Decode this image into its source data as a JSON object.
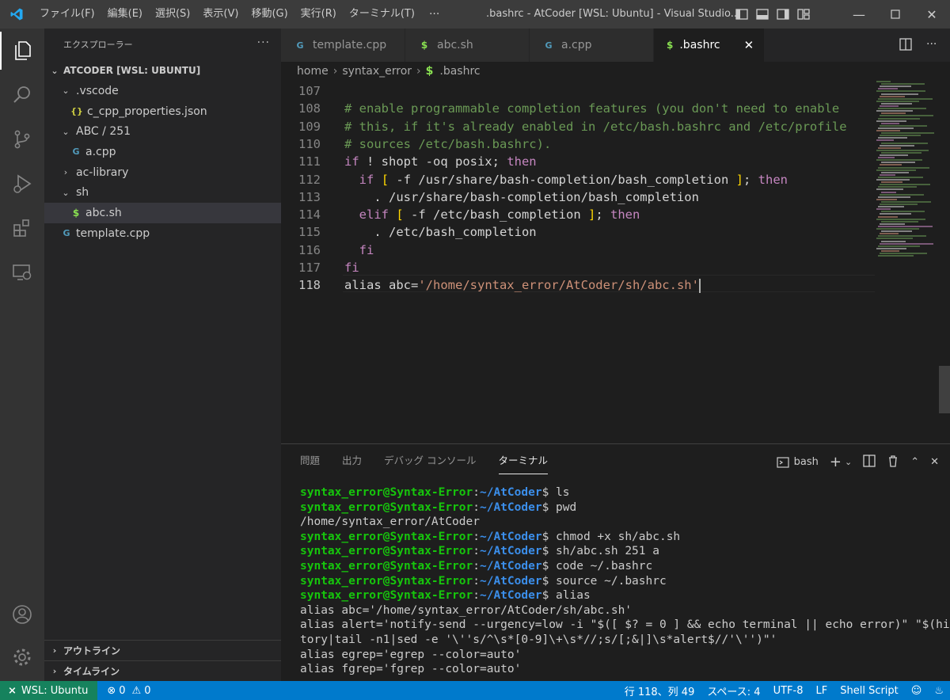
{
  "titlebar": {
    "menu": [
      "ファイル(F)",
      "編集(E)",
      "選択(S)",
      "表示(V)",
      "移動(G)",
      "実行(R)",
      "ターミナル(T)"
    ],
    "more": "···",
    "title": ".bashrc - AtCoder [WSL: Ubuntu] - Visual Studio..."
  },
  "sidebar": {
    "header": "エクスプローラー",
    "more": "···",
    "root": "ATCODER [WSL: UBUNTU]",
    "items": [
      {
        "label": ".vscode",
        "type": "folder",
        "expanded": true
      },
      {
        "label": "c_cpp_properties.json",
        "type": "json"
      },
      {
        "label": "ABC / 251",
        "type": "folder",
        "expanded": true
      },
      {
        "label": "a.cpp",
        "type": "cpp"
      },
      {
        "label": "ac-library",
        "type": "folder",
        "expanded": false
      },
      {
        "label": "sh",
        "type": "folder",
        "expanded": true
      },
      {
        "label": "abc.sh",
        "type": "sh",
        "selected": true
      },
      {
        "label": "template.cpp",
        "type": "cpp"
      }
    ],
    "outline": "アウトライン",
    "timeline": "タイムライン"
  },
  "tabs": [
    {
      "label": "template.cpp",
      "icon": "cpp"
    },
    {
      "label": "abc.sh",
      "icon": "sh"
    },
    {
      "label": "a.cpp",
      "icon": "cpp"
    },
    {
      "label": ".bashrc",
      "icon": "sh",
      "active": true
    }
  ],
  "breadcrumb": [
    "home",
    "syntax_error",
    ".bashrc"
  ],
  "editor": {
    "lines": [
      {
        "n": "107",
        "tokens": []
      },
      {
        "n": "108",
        "tokens": [
          {
            "t": "# enable programmable completion features (you don't need to enable",
            "c": "comment"
          }
        ]
      },
      {
        "n": "109",
        "tokens": [
          {
            "t": "# this, if it's already enabled in /etc/bash.bashrc and /etc/profile",
            "c": "comment"
          }
        ]
      },
      {
        "n": "110",
        "tokens": [
          {
            "t": "# sources /etc/bash.bashrc).",
            "c": "comment"
          }
        ]
      },
      {
        "n": "111",
        "tokens": [
          {
            "t": "if",
            "c": "kw"
          },
          {
            "t": " ! shopt -oq posix; ",
            "c": "plain"
          },
          {
            "t": "then",
            "c": "kw"
          }
        ]
      },
      {
        "n": "112",
        "tokens": [
          {
            "t": "  ",
            "c": "plain"
          },
          {
            "t": "if",
            "c": "kw"
          },
          {
            "t": " ",
            "c": "plain"
          },
          {
            "t": "[",
            "c": "br"
          },
          {
            "t": " -f /usr/share/bash-completion/bash_completion ",
            "c": "plain"
          },
          {
            "t": "]",
            "c": "br"
          },
          {
            "t": "; ",
            "c": "plain"
          },
          {
            "t": "then",
            "c": "kw"
          }
        ]
      },
      {
        "n": "113",
        "tokens": [
          {
            "t": "    . /usr/share/bash-completion/bash_completion",
            "c": "plain"
          }
        ]
      },
      {
        "n": "114",
        "tokens": [
          {
            "t": "  ",
            "c": "plain"
          },
          {
            "t": "elif",
            "c": "kw"
          },
          {
            "t": " ",
            "c": "plain"
          },
          {
            "t": "[",
            "c": "br"
          },
          {
            "t": " -f /etc/bash_completion ",
            "c": "plain"
          },
          {
            "t": "]",
            "c": "br"
          },
          {
            "t": "; ",
            "c": "plain"
          },
          {
            "t": "then",
            "c": "kw"
          }
        ]
      },
      {
        "n": "115",
        "tokens": [
          {
            "t": "    . /etc/bash_completion",
            "c": "plain"
          }
        ]
      },
      {
        "n": "116",
        "tokens": [
          {
            "t": "  ",
            "c": "plain"
          },
          {
            "t": "fi",
            "c": "kw"
          }
        ]
      },
      {
        "n": "117",
        "tokens": [
          {
            "t": "fi",
            "c": "kw"
          }
        ]
      },
      {
        "n": "118",
        "tokens": [
          {
            "t": "alias abc=",
            "c": "plain"
          },
          {
            "t": "'/home/syntax_error/AtCoder/sh/abc.sh'",
            "c": "str"
          }
        ],
        "current": true
      }
    ]
  },
  "panel": {
    "tabs": [
      "問題",
      "出力",
      "デバッグ コンソール",
      "ターミナル"
    ],
    "active_tab": "ターミナル",
    "shell": "bash",
    "terminal": [
      {
        "user": "syntax_error@Syntax-Error",
        "path": "~/AtCoder",
        "cmd": "ls"
      },
      {
        "user": "syntax_error@Syntax-Error",
        "path": "~/AtCoder",
        "cmd": "pwd"
      },
      {
        "out": "/home/syntax_error/AtCoder"
      },
      {
        "user": "syntax_error@Syntax-Error",
        "path": "~/AtCoder",
        "cmd": "chmod +x sh/abc.sh"
      },
      {
        "user": "syntax_error@Syntax-Error",
        "path": "~/AtCoder",
        "cmd": "sh/abc.sh 251 a"
      },
      {
        "user": "syntax_error@Syntax-Error",
        "path": "~/AtCoder",
        "cmd": "code ~/.bashrc"
      },
      {
        "user": "syntax_error@Syntax-Error",
        "path": "~/AtCoder",
        "cmd": "source ~/.bashrc"
      },
      {
        "user": "syntax_error@Syntax-Error",
        "path": "~/AtCoder",
        "cmd": "alias"
      },
      {
        "out": "alias abc='/home/syntax_error/AtCoder/sh/abc.sh'"
      },
      {
        "out": "alias alert='notify-send --urgency=low -i \"$([ $? = 0 ] && echo terminal || echo error)\" \"$(his"
      },
      {
        "out": "tory|tail -n1|sed -e '\\''s/^\\s*[0-9]\\+\\s*//;s/[;&|]\\s*alert$//'\\'')\"'"
      },
      {
        "out": "alias egrep='egrep --color=auto'"
      },
      {
        "out": "alias fgrep='fgrep --color=auto'"
      }
    ]
  },
  "statusbar": {
    "remote": "WSL: Ubuntu",
    "errors": "0",
    "warnings": "0",
    "position": "行 118、列 49",
    "spaces": "スペース: 4",
    "encoding": "UTF-8",
    "eol": "LF",
    "language": "Shell Script"
  },
  "colors": {
    "accent": "#007acc",
    "remote": "#16825d",
    "sh_icon": "#89e051",
    "cpp_icon": "#519aba",
    "json_icon": "#cbcb41"
  }
}
